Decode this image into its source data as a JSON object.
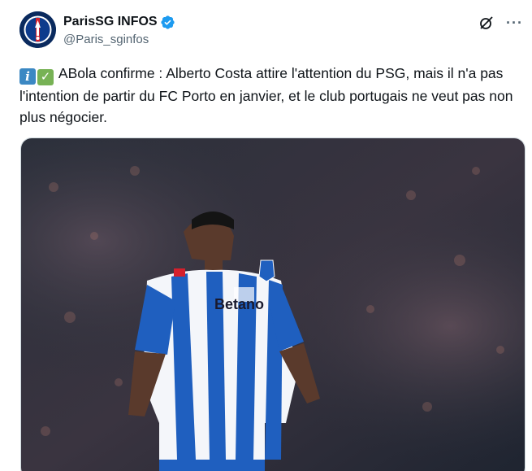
{
  "account": {
    "display_name": "ParisSG INFOS",
    "handle": "@Paris_sginfos",
    "verified": true,
    "avatar_icon": "psg-crest-icon"
  },
  "header_actions": {
    "grok_icon": "grok-icon",
    "more_label": "···"
  },
  "tweet": {
    "emoji_info": "i",
    "emoji_check": "✓",
    "text": "ABola confirme : Alberto Costa attire l'attention du PSG, mais il n'a pas l'intention de partir du FC Porto en janvier, et le club portugais ne veut pas non plus négocier."
  },
  "media": {
    "shirt_sponsor": "Betano",
    "accent_blue": "#1f5fbf",
    "kit_white": "#f4f6fa"
  },
  "colors": {
    "verified_blue": "#1d9bf0",
    "secondary_text": "#536471"
  }
}
